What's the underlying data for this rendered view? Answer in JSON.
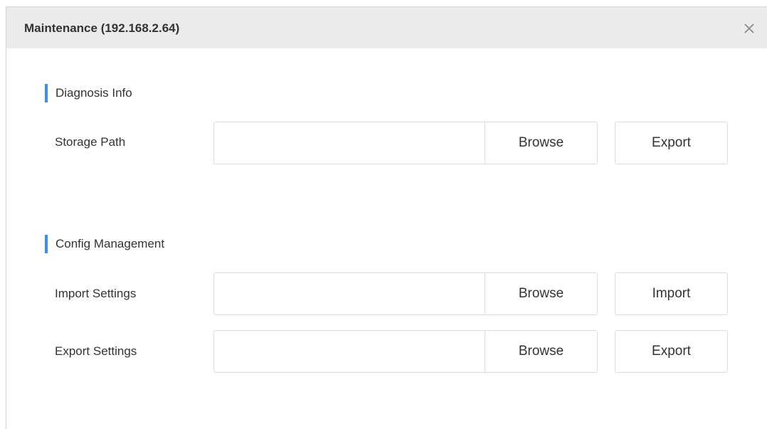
{
  "dialog": {
    "title": "Maintenance (192.168.2.64)",
    "close_icon": "close-icon"
  },
  "diagnosis": {
    "section_title": "Diagnosis Info",
    "storage_path": {
      "label": "Storage Path",
      "value": "",
      "browse_label": "Browse",
      "action_label": "Export"
    }
  },
  "config": {
    "section_title": "Config Management",
    "import_settings": {
      "label": "Import Settings",
      "value": "",
      "browse_label": "Browse",
      "action_label": "Import"
    },
    "export_settings": {
      "label": "Export Settings",
      "value": "",
      "browse_label": "Browse",
      "action_label": "Export"
    }
  },
  "colors": {
    "accent": "#3d8fe8",
    "titlebar_bg": "#ebebeb",
    "text": "#333333",
    "border": "#dcdcdc"
  }
}
